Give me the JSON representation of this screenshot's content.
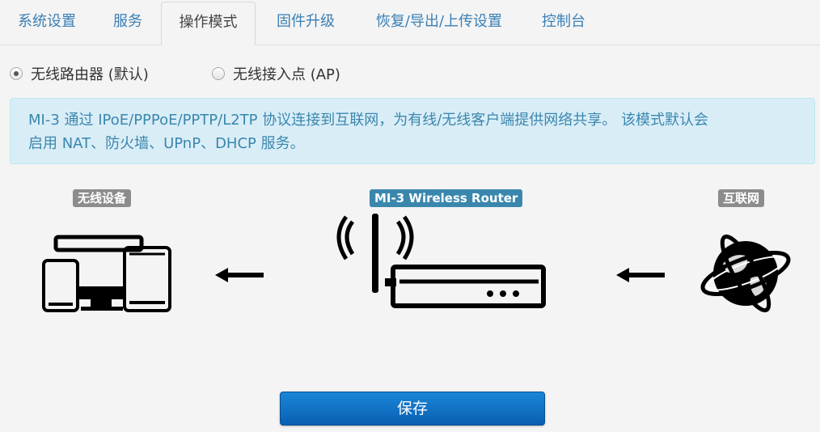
{
  "tabs": [
    {
      "label": "系统设置",
      "active": false
    },
    {
      "label": "服务",
      "active": false
    },
    {
      "label": "操作模式",
      "active": true
    },
    {
      "label": "固件升级",
      "active": false
    },
    {
      "label": "恢复/导出/上传设置",
      "active": false
    },
    {
      "label": "控制台",
      "active": false
    }
  ],
  "mode": {
    "options": [
      {
        "label": "无线路由器 (默认)",
        "checked": true
      },
      {
        "label": "无线接入点 (AP)",
        "checked": false
      }
    ]
  },
  "info": {
    "line1": "MI-3 通过 IPoE/PPPoE/PPTP/L2TP 协议连接到互联网，为有线/无线客户端提供网络共享。 该模式默认会",
    "line2": "启用 NAT、防火墙、UPnP、DHCP 服务。"
  },
  "diagram": {
    "devices_label": "无线设备",
    "router_label": "MI-3 Wireless Router",
    "internet_label": "互联网"
  },
  "actions": {
    "save_label": "保存"
  },
  "colors": {
    "tab_link": "#3a7fb5",
    "info_bg": "#d9edf7",
    "info_text": "#3a87ad",
    "router_pill": "#3a87ad",
    "gray_pill": "#8c8c8c",
    "save_button": "#0a5fb3"
  }
}
